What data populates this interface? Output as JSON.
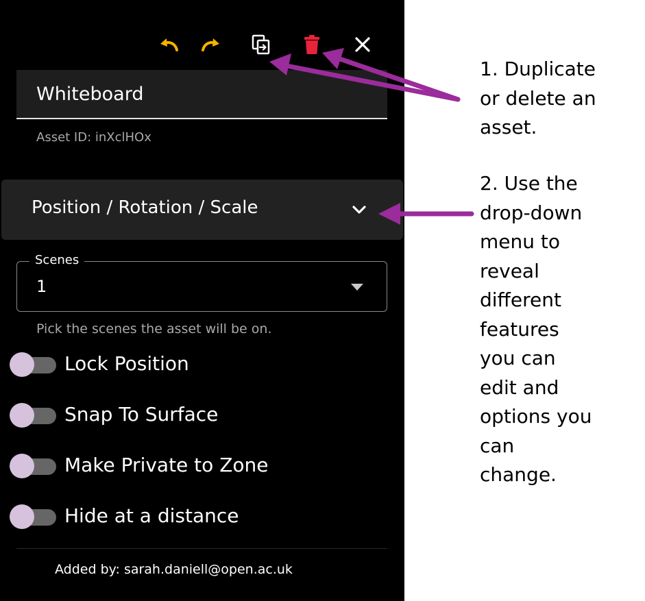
{
  "panel": {
    "toolbar": {
      "undo_icon": "undo-icon",
      "redo_icon": "redo-icon",
      "duplicate_icon": "duplicate-icon",
      "delete_icon": "trash-icon",
      "close_icon": "close-icon",
      "undo_color": "#f5b300",
      "delete_color": "#e8233a"
    },
    "asset_name": "Whiteboard",
    "asset_id": "Asset ID: inXclHOx",
    "accordion_label": "Position / Rotation / Scale",
    "scenes": {
      "legend": "Scenes",
      "value": "1",
      "helper": "Pick the scenes the asset will be on."
    },
    "toggles": [
      {
        "label": "Lock Position",
        "on": false
      },
      {
        "label": "Snap To Surface",
        "on": false
      },
      {
        "label": "Make Private to Zone",
        "on": false
      },
      {
        "label": "Hide at a distance",
        "on": false
      }
    ],
    "added_by": "Added by: sarah.daniell@open.ac.uk"
  },
  "annotations": {
    "note1": "1. Duplicate\nor delete an\nasset.",
    "note2": "2. Use the\ndrop-down\nmenu to\nreveal\ndifferent\nfeatures\nyou can\nedit and\noptions you\ncan\nchange.",
    "arrow_color": "#9b2c9b"
  }
}
